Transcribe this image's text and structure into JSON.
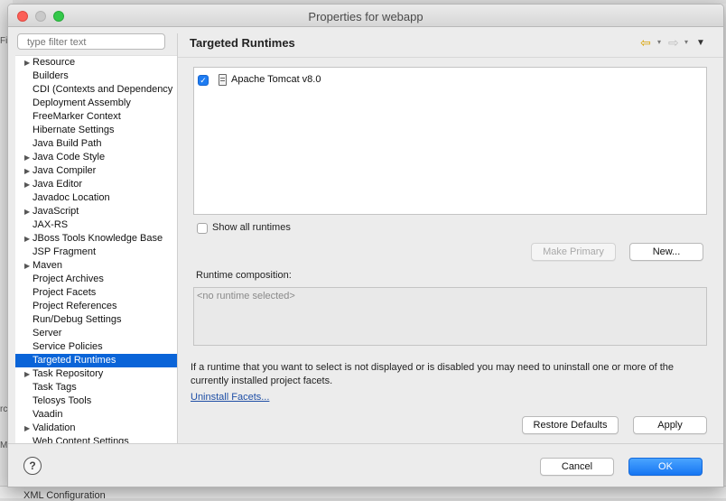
{
  "window": {
    "title": "Properties for webapp"
  },
  "filter": {
    "placeholder": "type filter text"
  },
  "tree": {
    "items": [
      {
        "label": "Resource",
        "expandable": true
      },
      {
        "label": "Builders",
        "expandable": false
      },
      {
        "label": "CDI (Contexts and Dependency",
        "expandable": false
      },
      {
        "label": "Deployment Assembly",
        "expandable": false
      },
      {
        "label": "FreeMarker Context",
        "expandable": false
      },
      {
        "label": "Hibernate Settings",
        "expandable": false
      },
      {
        "label": "Java Build Path",
        "expandable": false
      },
      {
        "label": "Java Code Style",
        "expandable": true
      },
      {
        "label": "Java Compiler",
        "expandable": true
      },
      {
        "label": "Java Editor",
        "expandable": true
      },
      {
        "label": "Javadoc Location",
        "expandable": false
      },
      {
        "label": "JavaScript",
        "expandable": true
      },
      {
        "label": "JAX-RS",
        "expandable": false
      },
      {
        "label": "JBoss Tools Knowledge Base",
        "expandable": true
      },
      {
        "label": "JSP Fragment",
        "expandable": false
      },
      {
        "label": "Maven",
        "expandable": true
      },
      {
        "label": "Project Archives",
        "expandable": false
      },
      {
        "label": "Project Facets",
        "expandable": false
      },
      {
        "label": "Project References",
        "expandable": false
      },
      {
        "label": "Run/Debug Settings",
        "expandable": false
      },
      {
        "label": "Server",
        "expandable": false
      },
      {
        "label": "Service Policies",
        "expandable": false
      },
      {
        "label": "Targeted Runtimes",
        "expandable": false,
        "selected": true
      },
      {
        "label": "Task Repository",
        "expandable": true
      },
      {
        "label": "Task Tags",
        "expandable": false
      },
      {
        "label": "Telosys Tools",
        "expandable": false
      },
      {
        "label": "Vaadin",
        "expandable": false
      },
      {
        "label": "Validation",
        "expandable": true
      },
      {
        "label": "Web Content Settings",
        "expandable": false
      }
    ]
  },
  "page": {
    "title": "Targeted Runtimes",
    "runtimes": [
      {
        "label": "Apache Tomcat v8.0",
        "checked": true
      }
    ],
    "show_all_label": "Show all runtimes",
    "show_all_checked": false,
    "make_primary_label": "Make Primary",
    "new_label": "New...",
    "composition_label": "Runtime composition:",
    "composition_empty": "<no runtime selected>",
    "info_text": "If a runtime that you want to select is not displayed or is disabled you may need to uninstall one or more of the currently installed project facets.",
    "uninstall_link": "Uninstall Facets...",
    "restore_defaults_label": "Restore Defaults",
    "apply_label": "Apply"
  },
  "footer": {
    "help_icon": "?",
    "cancel_label": "Cancel",
    "ok_label": "OK"
  },
  "background": {
    "bottom_text": "XML Configuration"
  },
  "colors": {
    "selection": "#0a64d8",
    "primary_button": "#1676f3",
    "back_arrow": "#d9a100",
    "link": "#1f4fa6"
  }
}
